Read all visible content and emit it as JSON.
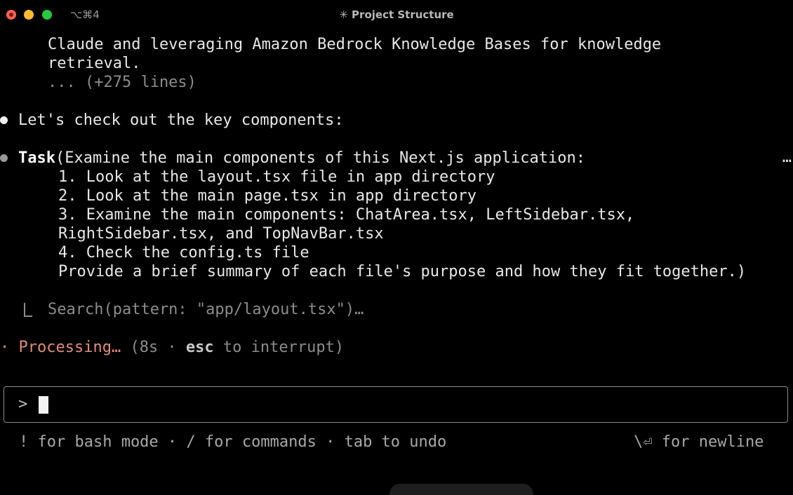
{
  "window": {
    "shortcut": "⌥⌘4",
    "title": "✳ Project Structure"
  },
  "output": {
    "line1": "Claude and leveraging Amazon Bedrock Knowledge Bases for knowledge",
    "line2": "retrieval.",
    "line3": "... (+275 lines)",
    "message": "Let's check out the key components:",
    "task_label": "Task",
    "task_header": "(Examine the main components of this Next.js application:",
    "task_ellipsis": "…",
    "task_lines": [
      "1. Look at the layout.tsx file in app directory",
      "2. Look at the main page.tsx in app directory",
      "3. Examine the main components: ChatArea.tsx, LeftSidebar.tsx,",
      "RightSidebar.tsx, and TopNavBar.tsx",
      "4. Check the config.ts file",
      "Provide a brief summary of each file's purpose and how they fit together.)"
    ],
    "search_line": "Search(pattern: \"app/layout.tsx\")…"
  },
  "status": {
    "dot": "·",
    "processing": "Processing…",
    "time": " (8s · ",
    "key": "esc",
    "rest": " to interrupt)"
  },
  "input": {
    "prompt": ">"
  },
  "footer": {
    "left": "! for bash mode · / for commands · tab to undo",
    "right": "\\⏎ for newline"
  }
}
